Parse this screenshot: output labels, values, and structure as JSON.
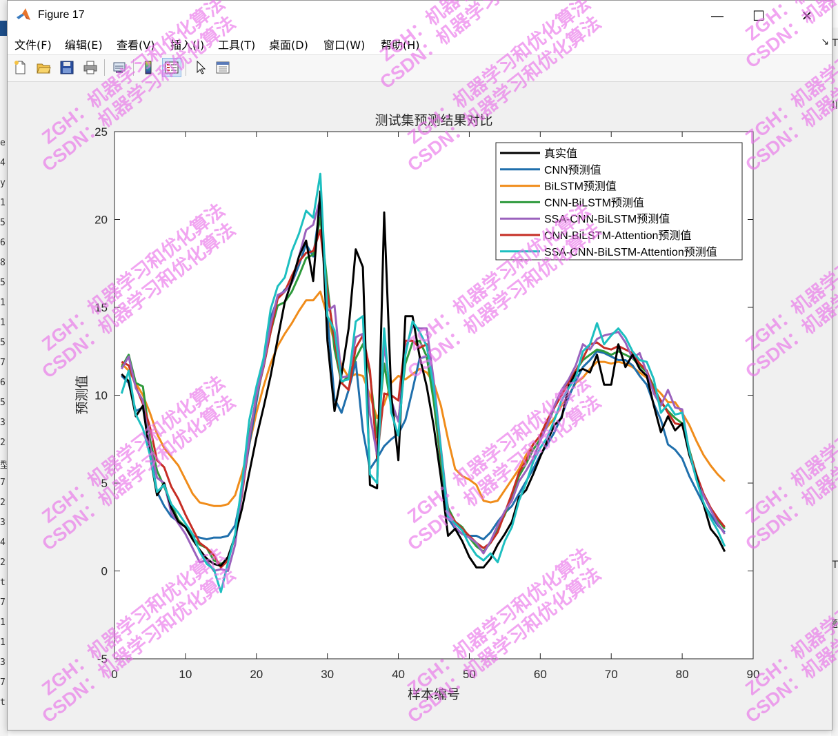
{
  "window": {
    "title": "Figure 17",
    "controls": {
      "minimize": "—",
      "maximize": "☐",
      "close": "✕"
    }
  },
  "menu": [
    "文件(F)",
    "编辑(E)",
    "查看(V)",
    "插入(I)",
    "工具(T)",
    "桌面(D)",
    "窗口(W)",
    "帮助(H)"
  ],
  "toolbar_icons": [
    "new-figure-icon",
    "open-icon",
    "save-icon",
    "print-icon",
    "link-icon",
    "colorbar-icon",
    "legend-icon",
    "pointer-icon",
    "property-inspector-icon"
  ],
  "background_text": {
    "left": [
      "e",
      "4",
      "y",
      "1",
      "5",
      "6",
      "8",
      "5",
      "1",
      "1",
      "5",
      "7",
      "6",
      "5",
      "3",
      "2",
      "型",
      "7",
      "2",
      "3",
      "4",
      "2",
      "t",
      "7",
      "1",
      "1",
      "3",
      "7",
      "t"
    ],
    "right": [
      "T",
      "川",
      "T",
      "题"
    ]
  },
  "watermark": [
    "ZGH：机器学习和优化算法",
    "CSDN：机器学习和优化算法"
  ],
  "chart_data": {
    "type": "line",
    "title": "测试集预测结果对比",
    "xlabel": "样本编号",
    "ylabel": "预测值",
    "xlim": [
      0,
      90
    ],
    "ylim": [
      -5,
      25
    ],
    "xticks": [
      0,
      10,
      20,
      30,
      40,
      50,
      60,
      70,
      80,
      90
    ],
    "yticks": [
      -5,
      0,
      5,
      10,
      15,
      20,
      25
    ],
    "grid": false,
    "legend_position": "top-right",
    "x": [
      1,
      2,
      3,
      4,
      5,
      6,
      7,
      8,
      9,
      10,
      11,
      12,
      13,
      14,
      15,
      16,
      17,
      18,
      19,
      20,
      21,
      22,
      23,
      24,
      25,
      26,
      27,
      28,
      29,
      30,
      31,
      32,
      33,
      34,
      35,
      36,
      37,
      38,
      39,
      40,
      41,
      42,
      43,
      44,
      45,
      46,
      47,
      48,
      49,
      50,
      51,
      52,
      53,
      54,
      55,
      56,
      57,
      58,
      59,
      60,
      61,
      62,
      63,
      64,
      65,
      66,
      67,
      68,
      69,
      70,
      71,
      72,
      73,
      74,
      75,
      76,
      77,
      78,
      79,
      80,
      81,
      82,
      83,
      84,
      85,
      86
    ],
    "series": [
      {
        "name": "真实值",
        "color": "#000000",
        "values": [
          11.2,
          10.8,
          8.8,
          9.4,
          6.6,
          4.3,
          5.0,
          3.6,
          2.8,
          2.5,
          1.8,
          1.2,
          0.7,
          0.4,
          0.3,
          0.8,
          2.0,
          3.6,
          5.6,
          7.6,
          9.3,
          11.1,
          13.2,
          15.3,
          16.5,
          17.9,
          18.8,
          16.5,
          21.6,
          13.1,
          9.1,
          11.2,
          13.8,
          18.3,
          17.3,
          4.9,
          4.7,
          20.4,
          10.0,
          6.3,
          14.5,
          14.5,
          12.2,
          10.5,
          8.2,
          5.3,
          2.0,
          2.4,
          1.7,
          0.8,
          0.2,
          0.2,
          0.7,
          1.5,
          2.1,
          2.8,
          4.2,
          4.6,
          5.5,
          6.5,
          7.4,
          8.3,
          8.7,
          10.5,
          11.3,
          11.5,
          11.3,
          12.3,
          10.6,
          10.6,
          12.9,
          11.6,
          12.3,
          11.5,
          11.1,
          9.4,
          7.9,
          8.8,
          8.0,
          8.4,
          6.6,
          5.4,
          3.8,
          2.4,
          1.9,
          1.1
        ]
      },
      {
        "name": "CNN预测值",
        "color": "#1f6fac",
        "values": [
          11.1,
          10.7,
          9.1,
          9.3,
          6.9,
          4.5,
          3.7,
          3.1,
          2.8,
          2.5,
          2.0,
          1.9,
          1.8,
          1.9,
          1.9,
          2.0,
          2.6,
          4.6,
          7.2,
          9.6,
          11.9,
          14.4,
          15.5,
          16.0,
          16.4,
          17.4,
          18.6,
          17.9,
          20.8,
          14.5,
          9.8,
          9.0,
          10.3,
          11.9,
          8.0,
          5.8,
          6.4,
          7.1,
          7.5,
          7.8,
          8.6,
          10.3,
          12.1,
          12.2,
          10.0,
          5.9,
          3.0,
          2.4,
          2.1,
          2.0,
          2.0,
          1.8,
          2.2,
          2.8,
          3.3,
          3.7,
          4.4,
          5.1,
          5.8,
          6.6,
          7.2,
          7.9,
          8.8,
          9.9,
          10.8,
          11.6,
          12.0,
          12.5,
          12.4,
          12.2,
          12.0,
          12.0,
          11.7,
          11.1,
          10.6,
          9.5,
          8.6,
          7.2,
          6.9,
          6.4,
          5.4,
          4.6,
          3.8,
          3.2,
          2.6,
          2.2
        ]
      },
      {
        "name": "BiLSTM预测值",
        "color": "#f08c1a",
        "values": [
          11.8,
          11.4,
          10.7,
          10.0,
          9.0,
          7.8,
          7.0,
          6.5,
          6.0,
          5.2,
          4.4,
          3.9,
          3.8,
          3.7,
          3.7,
          3.8,
          4.3,
          5.6,
          7.2,
          9.0,
          10.5,
          11.8,
          12.8,
          13.5,
          14.1,
          14.8,
          15.4,
          15.4,
          15.9,
          14.5,
          13.0,
          11.7,
          11.0,
          11.2,
          11.1,
          10.0,
          8.7,
          9.5,
          10.7,
          11.1,
          10.9,
          11.2,
          11.5,
          11.3,
          10.7,
          9.4,
          7.5,
          5.8,
          5.4,
          5.2,
          4.9,
          4.0,
          3.9,
          4.0,
          4.6,
          5.2,
          5.8,
          6.6,
          7.2,
          7.7,
          8.2,
          8.7,
          9.4,
          10.0,
          10.7,
          11.0,
          11.5,
          11.9,
          11.9,
          11.8,
          11.9,
          11.8,
          11.6,
          11.3,
          11.0,
          10.5,
          10.1,
          9.6,
          9.6,
          9.0,
          8.3,
          7.4,
          6.6,
          6.0,
          5.5,
          5.1
        ]
      },
      {
        "name": "CNN-BiLSTM预测值",
        "color": "#2e9a3c",
        "values": [
          11.6,
          12.3,
          10.7,
          10.5,
          7.5,
          5.7,
          4.8,
          3.8,
          2.9,
          2.5,
          1.9,
          1.5,
          1.3,
          0.6,
          0.4,
          0.6,
          2.0,
          4.8,
          7.8,
          9.9,
          11.6,
          13.6,
          15.1,
          15.3,
          15.9,
          16.8,
          17.8,
          18.0,
          20.1,
          16.3,
          12.6,
          10.7,
          11.1,
          12.1,
          12.9,
          11.2,
          7.6,
          11.8,
          9.3,
          8.6,
          11.8,
          13.0,
          13.1,
          12.2,
          9.6,
          6.1,
          3.6,
          2.8,
          2.5,
          1.9,
          1.4,
          1.1,
          1.6,
          2.4,
          3.2,
          4.2,
          5.4,
          6.1,
          6.9,
          7.5,
          8.3,
          9.3,
          10.1,
          10.7,
          11.4,
          12.0,
          12.3,
          12.6,
          12.5,
          12.3,
          12.5,
          12.3,
          12.1,
          11.7,
          11.3,
          10.5,
          9.6,
          9.1,
          8.7,
          8.4,
          6.9,
          5.5,
          4.3,
          3.5,
          2.9,
          2.4
        ]
      },
      {
        "name": "SSA-CNN-BiLSTM预测值",
        "color": "#9b62bd",
        "values": [
          11.5,
          12.2,
          10.4,
          9.7,
          7.1,
          5.3,
          5.0,
          3.3,
          2.7,
          2.1,
          1.3,
          0.5,
          0.6,
          0.0,
          0.1,
          0.0,
          1.5,
          4.6,
          7.6,
          10.0,
          11.7,
          14.0,
          15.7,
          15.9,
          16.4,
          17.9,
          19.4,
          19.7,
          21.2,
          14.8,
          15.1,
          11.0,
          11.1,
          13.3,
          13.5,
          8.9,
          6.6,
          12.9,
          9.7,
          8.5,
          12.6,
          13.9,
          13.8,
          13.8,
          10.8,
          7.0,
          3.4,
          2.5,
          2.1,
          1.9,
          1.6,
          1.0,
          1.7,
          2.6,
          3.4,
          4.0,
          5.1,
          5.7,
          6.4,
          7.4,
          8.3,
          9.4,
          10.3,
          10.9,
          11.7,
          12.9,
          12.6,
          13.2,
          13.4,
          13.5,
          13.6,
          13.0,
          12.1,
          12.4,
          11.3,
          10.1,
          9.4,
          10.3,
          9.3,
          9.2,
          6.7,
          5.2,
          4.3,
          3.5,
          2.7,
          2.1
        ]
      },
      {
        "name": "CNN-BiLSTM-Attention预测值",
        "color": "#c62d24",
        "values": [
          11.9,
          11.7,
          10.5,
          9.5,
          8.2,
          6.3,
          5.9,
          4.8,
          4.1,
          3.2,
          2.4,
          1.6,
          1.3,
          0.9,
          0.2,
          0.6,
          2.0,
          4.4,
          7.5,
          10.0,
          11.6,
          13.6,
          15.5,
          15.9,
          16.8,
          17.6,
          18.1,
          18.2,
          19.4,
          15.8,
          13.2,
          10.7,
          10.3,
          12.7,
          13.4,
          11.4,
          6.4,
          10.1,
          10.0,
          9.7,
          13.1,
          13.1,
          12.7,
          12.9,
          10.5,
          6.6,
          3.4,
          2.8,
          2.4,
          2.0,
          1.6,
          1.3,
          1.6,
          2.2,
          3.3,
          4.4,
          5.6,
          6.3,
          7.2,
          7.7,
          8.6,
          9.3,
          10.0,
          10.7,
          11.4,
          12.1,
          12.9,
          13.0,
          12.7,
          12.6,
          12.8,
          12.6,
          12.4,
          11.8,
          11.4,
          10.3,
          9.7,
          9.0,
          8.4,
          8.3,
          6.8,
          5.5,
          4.4,
          3.6,
          3.0,
          2.5
        ]
      },
      {
        "name": "SSA-CNN-BiLSTM-Attention预测值",
        "color": "#1dbfc0",
        "values": [
          10.1,
          11.4,
          8.9,
          8.1,
          6.6,
          4.5,
          4.9,
          3.8,
          3.3,
          2.7,
          2.1,
          1.1,
          0.4,
          0.1,
          -1.2,
          0.5,
          2.1,
          5.1,
          8.6,
          10.5,
          12.1,
          14.9,
          16.2,
          16.7,
          18.2,
          19.2,
          20.5,
          20.1,
          22.6,
          14.5,
          13.7,
          10.8,
          10.9,
          14.2,
          14.5,
          5.5,
          5.0,
          13.8,
          9.0,
          7.7,
          12.3,
          14.2,
          13.6,
          12.8,
          10.4,
          6.9,
          3.1,
          2.7,
          2.3,
          1.5,
          0.9,
          0.6,
          1.0,
          0.5,
          1.7,
          2.5,
          4.0,
          5.0,
          6.2,
          7.0,
          7.6,
          8.6,
          9.7,
          10.4,
          11.0,
          12.5,
          12.9,
          14.1,
          12.9,
          13.4,
          13.8,
          13.3,
          12.5,
          12.0,
          11.9,
          10.9,
          9.0,
          9.5,
          8.9,
          9.0,
          6.8,
          5.2,
          3.9,
          3.0,
          2.3,
          1.4
        ]
      }
    ]
  }
}
